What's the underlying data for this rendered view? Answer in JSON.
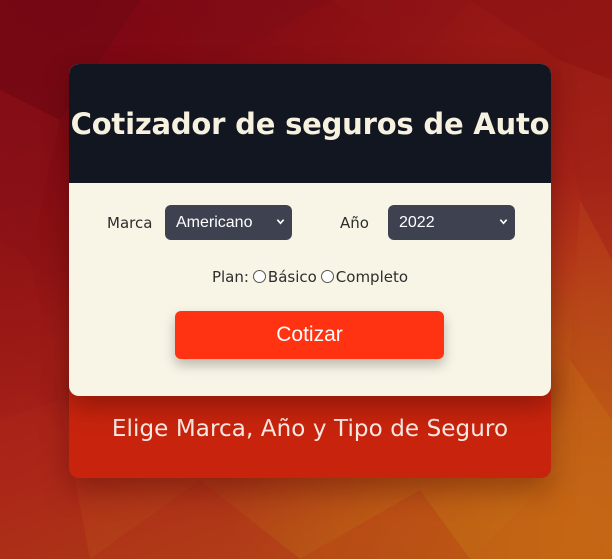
{
  "form": {
    "title": "Cotizador de seguros de Auto",
    "brand_label": "Marca",
    "brand_value": "Americano",
    "year_label": "Año",
    "year_value": "2022",
    "plan_label": "Plan:",
    "plan_options": [
      "Básico",
      "Completo"
    ],
    "submit_label": "Cotizar"
  },
  "result": {
    "message": "Elige Marca, Año y Tipo de Seguro"
  },
  "colors": {
    "header_bg": "#121621",
    "card_bg": "#f8f4e6",
    "select_bg": "#3e4150",
    "button_bg": "#ff3311",
    "result_bg": "#c8240d"
  },
  "icons": {
    "select_arrow": "chevron-down-icon"
  }
}
